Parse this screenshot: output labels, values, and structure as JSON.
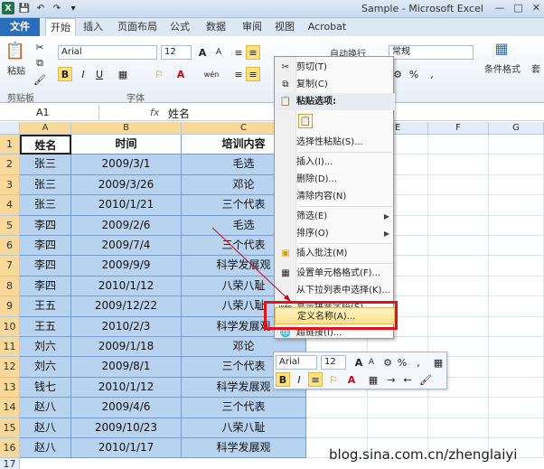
{
  "window": {
    "title": "Sample - Microsoft Excel",
    "icons": [
      "excel-logo",
      "save-icon",
      "undo-icon",
      "redo-icon",
      "customize-qat-icon"
    ],
    "controls": [
      "minimize-icon",
      "restore-icon",
      "close-icon"
    ]
  },
  "tabs": [
    "文件",
    "开始",
    "插入",
    "页面布局",
    "公式",
    "数据",
    "审阅",
    "视图",
    "Acrobat"
  ],
  "active_tab": "开始",
  "ribbon": {
    "paste_label": "粘贴",
    "clipboard_label": "剪贴板",
    "font_label": "字体",
    "font_name": "Arial",
    "font_size": "12",
    "wrap_text": "自动换行",
    "number_format": "常规",
    "conditional_format": "条件格式",
    "cell_styles": "套",
    "bold": "B",
    "italic": "I",
    "underline": "U",
    "font_color": "A",
    "grow_font": "A",
    "shrink_font": "A",
    "phonetic": "wén",
    "percent": "%"
  },
  "formula_bar": {
    "name_box": "A1",
    "fx": "fx",
    "value": "姓名"
  },
  "grid": {
    "columns": [
      "A",
      "B",
      "C",
      "D",
      "E",
      "F",
      "G",
      "H"
    ],
    "rows": [
      "1",
      "2",
      "3",
      "4",
      "5",
      "6",
      "7",
      "8",
      "9",
      "10",
      "11",
      "12",
      "13",
      "14",
      "15",
      "16",
      "17"
    ],
    "header": [
      "姓名",
      "时间",
      "培训内容"
    ],
    "data": [
      [
        "张三",
        "2009/3/1",
        "毛选"
      ],
      [
        "张三",
        "2009/3/26",
        "邓论"
      ],
      [
        "张三",
        "2010/1/21",
        "三个代表"
      ],
      [
        "李四",
        "2009/2/6",
        "毛选"
      ],
      [
        "李四",
        "2009/7/4",
        "三个代表"
      ],
      [
        "李四",
        "2009/9/9",
        "科学发展观"
      ],
      [
        "李四",
        "2010/1/12",
        "八荣八耻"
      ],
      [
        "王五",
        "2009/12/22",
        "八荣八耻"
      ],
      [
        "王五",
        "2010/2/3",
        "科学发展观"
      ],
      [
        "刘六",
        "2009/1/18",
        "邓论"
      ],
      [
        "刘六",
        "2009/8/1",
        "三个代表"
      ],
      [
        "钱七",
        "2010/1/12",
        "科学发展观"
      ],
      [
        "赵八",
        "2009/4/6",
        "三个代表"
      ],
      [
        "赵八",
        "2009/10/23",
        "八荣八耻"
      ],
      [
        "赵八",
        "2010/1/17",
        "科学发展观"
      ]
    ]
  },
  "context_menu": {
    "cut": "剪切(T)",
    "copy": "复制(C)",
    "paste_options": "粘贴选项:",
    "paste_special": "选择性粘贴(S)...",
    "insert": "插入(I)...",
    "delete": "删除(D)...",
    "clear": "清除内容(N)",
    "filter": "筛选(E)",
    "sort": "排序(O)",
    "insert_comment": "插入批注(M)",
    "format_cells": "设置单元格格式(F)...",
    "pick_list": "从下拉列表中选择(K)...",
    "phonetic": "显示拼音字段(S)",
    "define_name": "定义名称(A)...",
    "hyperlink": "超链接(I)..."
  },
  "mini_toolbar": {
    "font": "Arial",
    "size": "12",
    "bold": "B",
    "italic": "I",
    "font_color": "A",
    "percent": "%",
    "comma": ","
  },
  "watermark": "blog.sina.com.cn/zhenglaiyi",
  "colors": {
    "selection_fill": "#b8d3ef",
    "highlight_border": "#e1141b",
    "file_tab": "#2a6db8"
  }
}
